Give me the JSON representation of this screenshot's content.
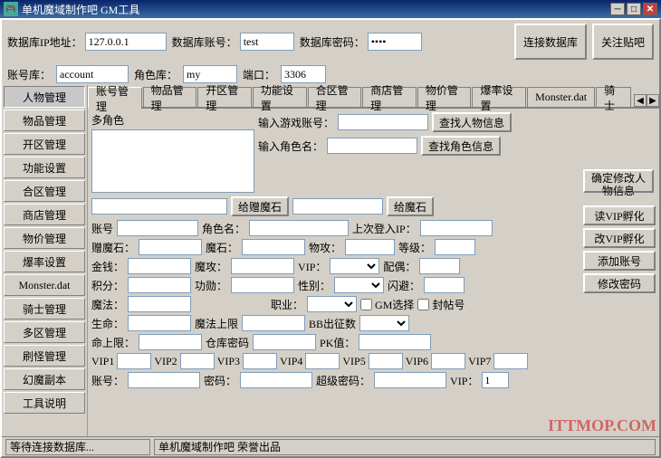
{
  "titlebar": {
    "icon": "🎮",
    "title": "单机魔域制作吧 GM工具",
    "minimize": "─",
    "maximize": "□",
    "close": "✕"
  },
  "config": {
    "db_ip_label": "数据库IP地址：",
    "db_ip_value": "127.0.0.1",
    "db_account_label": "数据库账号：",
    "db_account_value": "test",
    "db_password_label": "数据库密码：",
    "db_password_value": "****",
    "connect_db_btn": "连接数据库",
    "close_post_btn": "关注贴吧",
    "account_label": "账号库：",
    "account_value": "account",
    "role_db_label": "角色库：",
    "role_db_value": "my",
    "port_label": "端口：",
    "port_value": "3306"
  },
  "sidebar": {
    "items": [
      {
        "label": "人物管理",
        "id": "renwu"
      },
      {
        "label": "物品管理",
        "id": "wupin"
      },
      {
        "label": "开区管理",
        "id": "kaiqu"
      },
      {
        "label": "功能设置",
        "id": "gongneng"
      },
      {
        "label": "合区管理",
        "id": "hequ"
      },
      {
        "label": "商店管理",
        "id": "shangdian"
      },
      {
        "label": "物价管理",
        "id": "wujia"
      },
      {
        "label": "爆率设置",
        "id": "baolv"
      },
      {
        "label": "Monster.dat",
        "id": "monster"
      },
      {
        "label": "骑士管理",
        "id": "qishi"
      },
      {
        "label": "多区管理",
        "id": "duoqu"
      },
      {
        "label": "刷怪管理",
        "id": "shuaiguai"
      },
      {
        "label": "幻魔副本",
        "id": "huanmo"
      },
      {
        "label": "工具说明",
        "id": "gongju"
      }
    ]
  },
  "tabs": {
    "items": [
      {
        "label": "账号管理",
        "active": true
      },
      {
        "label": "物品管理"
      },
      {
        "label": "开区管理"
      },
      {
        "label": "功能设置"
      },
      {
        "label": "合区管理"
      },
      {
        "label": "商店管理"
      },
      {
        "label": "物价管理"
      },
      {
        "label": "爆率设置"
      },
      {
        "label": "Monster.dat"
      },
      {
        "label": "骑士"
      }
    ]
  },
  "panel": {
    "multi_char_label": "多角色",
    "game_account_label": "输入游戏账号：",
    "char_name_label": "输入角色名：",
    "find_account_btn": "查找人物信息",
    "find_char_btn": "查找角色信息",
    "gift_stone_btn": "给赠魔石",
    "gift_stone_btn2": "给魔石",
    "account_label": "账号",
    "char_name_label2": "角色名：",
    "last_login_label": "上次登入IP：",
    "gift_stone_label": "赠魔石：",
    "magic_stone_label": "魔石：",
    "phys_atk_label": "物攻：",
    "level_label": "等级：",
    "gold_label": "金钱：",
    "magic_label": "魔攻：",
    "vip_label": "VIP：",
    "partner_label": "配偶：",
    "points_label": "积分：",
    "merit_label": "功勋：",
    "gender_label": "性别：",
    "flash_label": "闪避：",
    "spell_label": "魔法：",
    "job_label": "职业：",
    "gm_select_label": "GM选择",
    "seal_label": "封帖号",
    "life_label": "生命：",
    "max_magic_label": "魔法上限",
    "bb_count_label": "BB出征数",
    "life_limit_label": "命上限：",
    "warehouse_pwd_label": "仓库密码",
    "pk_label": "PK值：",
    "confirm_btn": "确定修改人物信息",
    "vip1_label": "VIP1",
    "vip2_label": "VIP2",
    "vip3_label": "VIP3",
    "vip4_label": "VIP4",
    "vip5_label": "VIP5",
    "vip6_label": "VIP6",
    "vip7_label": "VIP7",
    "account2_label": "账号：",
    "password_label": "密码：",
    "super_pwd_label": "超级密码：",
    "vip2_label_right": "VIP：",
    "vip2_value": "1",
    "read_vip_btn": "读VIP孵化",
    "change_vip_btn": "改VIP孵化",
    "add_account_btn": "添加账号",
    "change_pwd_btn": "修改密码"
  },
  "statusbar": {
    "waiting": "等待连接数据库...",
    "credit": "单机魔域制作吧 荣誉出品"
  },
  "watermark": "ITTMOP.COM"
}
